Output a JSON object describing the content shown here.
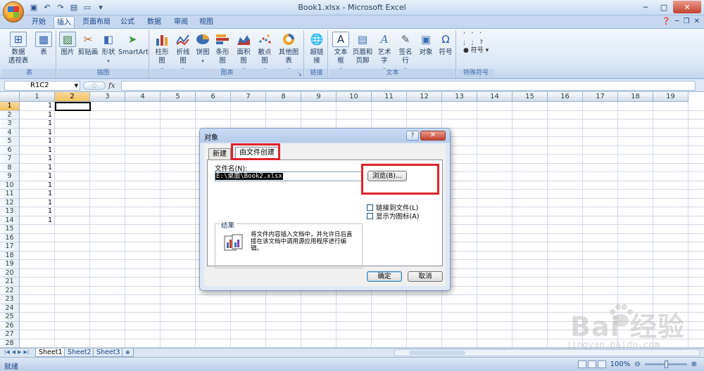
{
  "window": {
    "title": "Book1.xlsx - Microsoft Excel",
    "controls": {
      "minimize": "─",
      "maximize": "□",
      "close": "✕"
    }
  },
  "tabs": [
    "开始",
    "插入",
    "页面布局",
    "公式",
    "数据",
    "审阅",
    "视图"
  ],
  "active_tab": "插入",
  "ribbon": {
    "groups": {
      "tables": "表",
      "illustrations": "插图",
      "charts": "图表",
      "links": "链接",
      "text": "文本",
      "symbols": "特殊符号"
    },
    "buttons": {
      "pivot_table": [
        "数据",
        "透视表"
      ],
      "table": "表",
      "picture": "图片",
      "clipart": "剪贴画",
      "shapes": "形状",
      "smartart": "SmartArt",
      "column": "柱形图",
      "line": "折线图",
      "pie": "饼图",
      "bar": "条形图",
      "area": "面积图",
      "scatter": "散点图",
      "other_charts": "其他图表",
      "hyperlink": "超链接",
      "textbox": "文本框",
      "header_footer": [
        "页眉和",
        "页脚"
      ],
      "wordart": "艺术字",
      "signature": "签名行",
      "object": "对象",
      "symbol": "符号",
      "special_symbol": "符号"
    }
  },
  "formula_bar": {
    "name_box": "R1C2",
    "fx": "fx",
    "value": ""
  },
  "grid": {
    "columns": [
      "1",
      "2",
      "3",
      "4",
      "5",
      "6",
      "7",
      "8",
      "9",
      "10",
      "11",
      "12",
      "13",
      "14",
      "15",
      "16",
      "17",
      "18",
      "19"
    ],
    "rows": [
      "1",
      "2",
      "3",
      "4",
      "5",
      "6",
      "7",
      "8",
      "9",
      "10",
      "11",
      "12",
      "13",
      "14",
      "15",
      "16",
      "17",
      "18",
      "19",
      "20",
      "21",
      "22",
      "23",
      "24",
      "25",
      "26",
      "27",
      "28"
    ],
    "column1_values": [
      "1",
      "1",
      "1",
      "1",
      "1",
      "1",
      "1",
      "1",
      "1",
      "1",
      "1",
      "1",
      "1",
      "1"
    ],
    "active_cell": "R1C2"
  },
  "sheets": [
    "Sheet1",
    "Sheet2",
    "Sheet3"
  ],
  "status": {
    "text": "就绪",
    "zoom": "100%"
  },
  "dialog": {
    "title": "对象",
    "help": "?",
    "close": "✕",
    "tabs": [
      "新建",
      "由文件创建"
    ],
    "active_tab": "由文件创建",
    "file_label": "文件名(N):",
    "file_value": "E:\\桌面\\Book2.xlsx",
    "browse": "浏览(B)...",
    "link_to_file": "链接到文件(L)",
    "display_as_icon": "显示为图标(A)",
    "result_label": "结果",
    "result_text": "将文件内容插入文档中，并允许日后直接在该文档中调用源应用程序进行编辑。",
    "ok": "确定",
    "cancel": "取消"
  },
  "watermark": {
    "brand": "Bai  经验",
    "url": "jingyan.baidu.com"
  },
  "colors": {
    "highlight": "#e0232b",
    "ribbon": "#dbe7f5",
    "selection_header": "#f1c15f"
  }
}
